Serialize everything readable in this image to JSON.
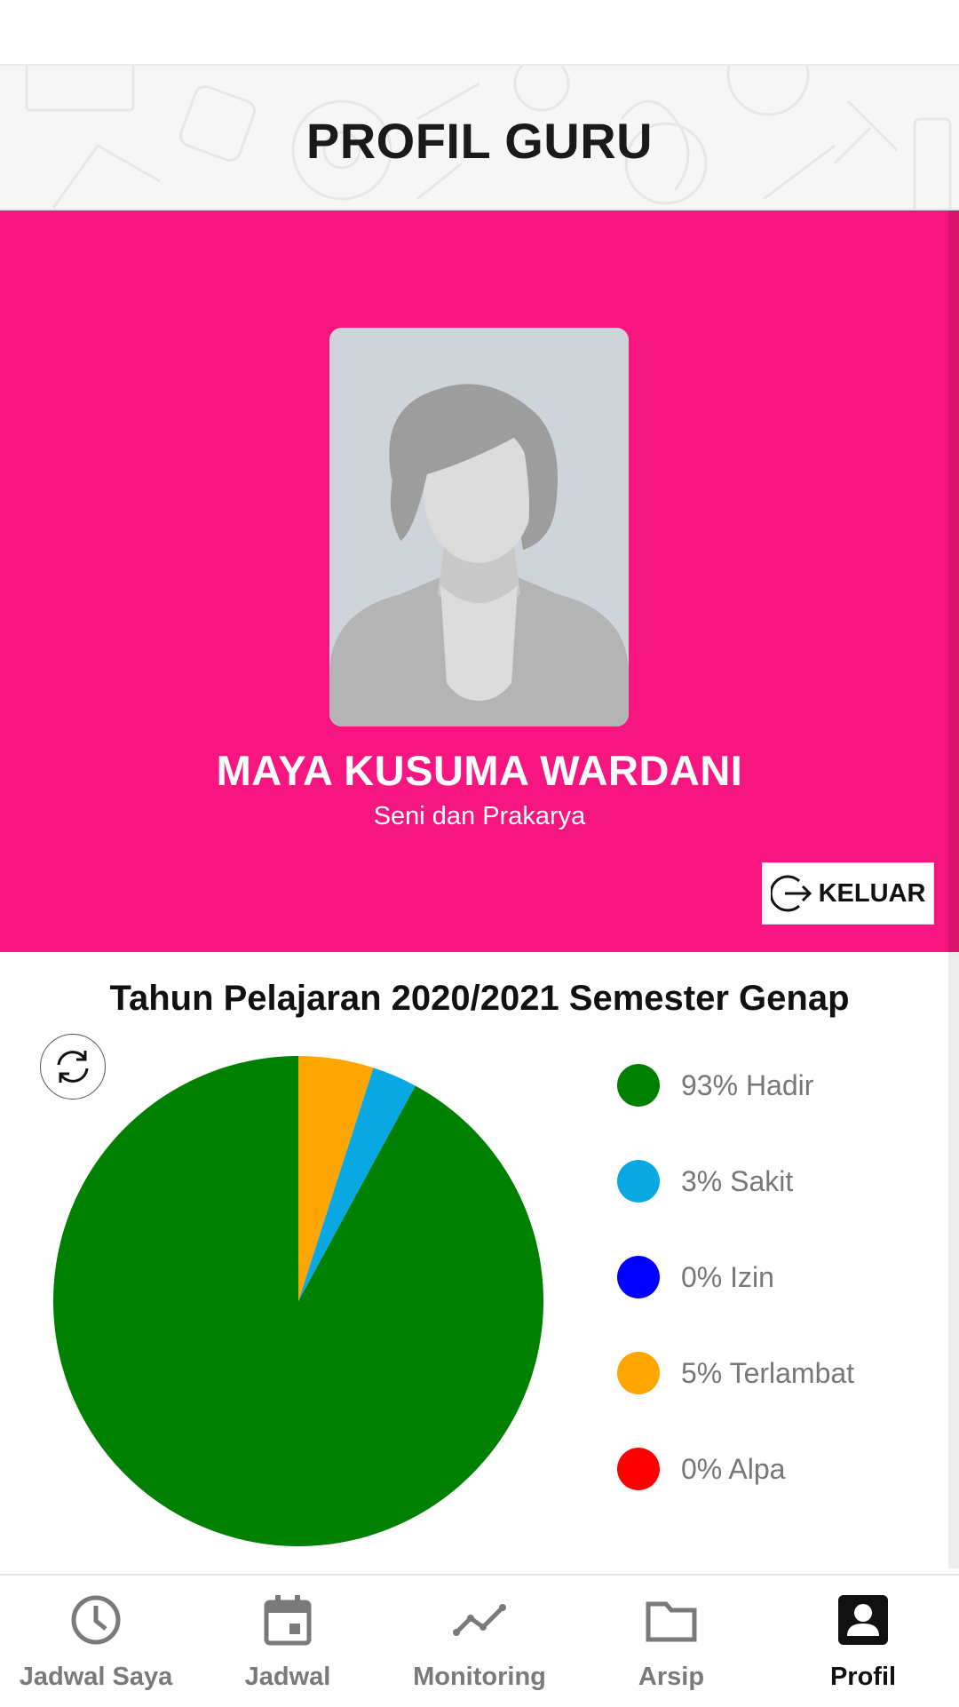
{
  "header": {
    "title": "PROFIL GURU"
  },
  "profile": {
    "name": "MAYA KUSUMA WARDANI",
    "subject": "Seni dan Prakarya",
    "photo_icon": "female-avatar-placeholder",
    "logout_label": "KELUAR",
    "logout_icon": "logout-icon"
  },
  "colors": {
    "brand_pink": "#f7167f",
    "hadir": "#008000",
    "sakit": "#0aa8e3",
    "izin": "#0000ff",
    "terlambat": "#ffa500",
    "alpa": "#ff0000"
  },
  "stats": {
    "period_title": "Tahun Pelajaran 2020/2021 Semester Genap",
    "refresh_icon": "refresh-icon",
    "legend": [
      {
        "label": "93% Hadir",
        "color": "#008000"
      },
      {
        "label": "3% Sakit",
        "color": "#0aa8e3"
      },
      {
        "label": "0% Izin",
        "color": "#0000ff"
      },
      {
        "label": "5% Terlambat",
        "color": "#ffa500"
      },
      {
        "label": "0% Alpa",
        "color": "#ff0000"
      }
    ]
  },
  "chart_data": {
    "type": "pie",
    "categories": [
      "Hadir",
      "Sakit",
      "Izin",
      "Terlambat",
      "Alpa"
    ],
    "values": [
      93,
      3,
      0,
      5,
      0
    ],
    "colors": [
      "#008000",
      "#0aa8e3",
      "#0000ff",
      "#ffa500",
      "#ff0000"
    ],
    "title": "Tahun Pelajaran 2020/2021 Semester Genap",
    "legend": "right"
  },
  "nav": {
    "items": [
      {
        "label": "Jadwal Saya",
        "icon": "clock-icon",
        "active": false
      },
      {
        "label": "Jadwal",
        "icon": "calendar-icon",
        "active": false
      },
      {
        "label": "Monitoring",
        "icon": "trend-line-icon",
        "active": false
      },
      {
        "label": "Arsip",
        "icon": "folder-icon",
        "active": false
      },
      {
        "label": "Profil",
        "icon": "profile-badge-icon",
        "active": true
      }
    ]
  }
}
